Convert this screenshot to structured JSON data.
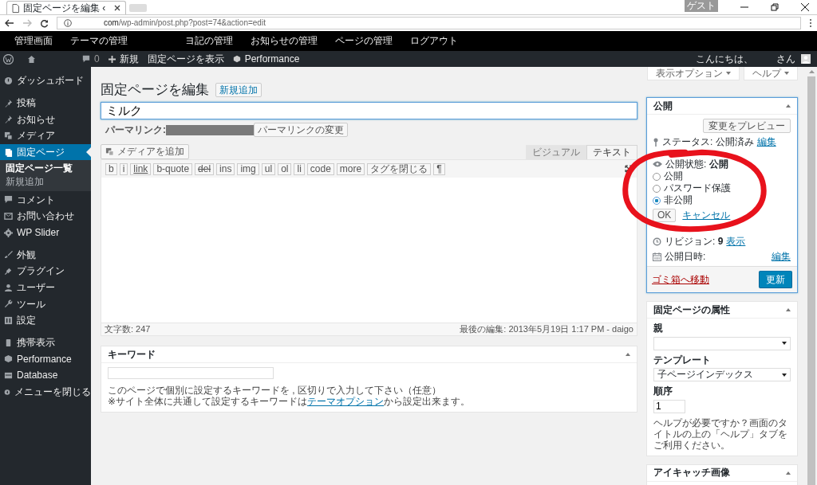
{
  "browser": {
    "tab_title": "固定ページを編集 ‹",
    "url_host": "com",
    "url_path": "/wp-admin/post.php?post=74&action=edit",
    "profile": "ゲスト"
  },
  "site_nav": [
    "管理画面",
    "テーマの管理",
    "ヨ記の管理",
    "お知らせの管理",
    "ページの管理",
    "ログアウト"
  ],
  "admin_bar": {
    "comments": "0",
    "new": "新規",
    "view": "固定ページを表示",
    "performance": "Performance",
    "greeting": "こんにちは、",
    "user": "さん"
  },
  "sidebar": [
    {
      "items": [
        {
          "label": "ダッシュボード",
          "selected": false
        }
      ]
    },
    {
      "items": [
        {
          "label": "投稿",
          "selected": false
        },
        {
          "label": "お知らせ",
          "selected": false
        },
        {
          "label": "メディア",
          "selected": false
        },
        {
          "label": "固定ページ",
          "selected": true,
          "children": [
            {
              "label": "固定ページ一覧",
              "selected": true
            },
            {
              "label": "新規追加",
              "selected": false
            }
          ]
        },
        {
          "label": "コメント",
          "selected": false
        },
        {
          "label": "お問い合わせ",
          "selected": false
        },
        {
          "label": "WP Slider",
          "selected": false
        }
      ]
    },
    {
      "items": [
        {
          "label": "外観",
          "selected": false
        },
        {
          "label": "プラグイン",
          "selected": false
        },
        {
          "label": "ユーザー",
          "selected": false
        },
        {
          "label": "ツール",
          "selected": false
        },
        {
          "label": "設定",
          "selected": false
        }
      ]
    },
    {
      "items": [
        {
          "label": "携帯表示",
          "selected": false
        },
        {
          "label": "Performance",
          "selected": false
        },
        {
          "label": "Database",
          "selected": false
        },
        {
          "label": "メニューを閉じる",
          "selected": false
        }
      ]
    }
  ],
  "screen_options": "表示オプション",
  "help": "ヘルプ",
  "page": {
    "heading": "固定ページを編集",
    "add_new": "新規追加",
    "title": "ミルク",
    "permalink_label": "パーマリンク:",
    "permalink_button": "パーマリンクの変更",
    "add_media": "メディアを追加",
    "editor_tabs": [
      {
        "label": "ビジュアル",
        "selected": false
      },
      {
        "label": "テキスト",
        "selected": true
      }
    ],
    "quicktags": [
      {
        "label": "b",
        "kind": "plain"
      },
      {
        "label": "i",
        "kind": "plain"
      },
      {
        "label": "link",
        "kind": "underline"
      },
      {
        "label": "b-quote",
        "kind": "plain"
      },
      {
        "label": "del",
        "kind": "strike"
      },
      {
        "label": "ins",
        "kind": "plain"
      },
      {
        "label": "img",
        "kind": "plain"
      },
      {
        "label": "ul",
        "kind": "plain"
      },
      {
        "label": "ol",
        "kind": "plain"
      },
      {
        "label": "li",
        "kind": "plain"
      },
      {
        "label": "code",
        "kind": "plain"
      },
      {
        "label": "more",
        "kind": "plain"
      },
      {
        "label": "タグを閉じる",
        "kind": "plain"
      },
      {
        "label": "¶",
        "kind": "plain"
      }
    ],
    "word_count": "文字数: 247",
    "last_edit": "最後の編集: 2013年5月19日 1:17 PM - daigo"
  },
  "keywords": {
    "title": "キーワード",
    "help_1": "このページで個別に設定するキーワードを , 区切りで入力して下さい（任意）",
    "help_2_before": "※サイト全体に共通して設定するキーワードは",
    "help_2_link": "テーマオプション",
    "help_2_after": "から設定出来ます。"
  },
  "publish": {
    "title": "公開",
    "preview": "変更をプレビュー",
    "status": "ステータス: 公開済み",
    "status_edit": "編集",
    "visibility": "公開状態: **公開**",
    "radios": [
      {
        "label": "公開",
        "selected": false
      },
      {
        "label": "パスワード保護",
        "selected": false
      },
      {
        "label": "非公開",
        "selected": true
      }
    ],
    "ok": "OK",
    "cancel": "キャンセル",
    "revisions": "リビジョン: **9**",
    "revisions_link": "表示",
    "date": "公開日時:",
    "date_edit": "編集",
    "trash": "ゴミ箱へ移動",
    "update": "更新"
  },
  "attributes": {
    "title": "固定ページの属性",
    "parent_label": "親",
    "template_label": "テンプレート",
    "template": "子ページインデックス",
    "order_label": "順序",
    "order": "1",
    "help": "ヘルプが必要ですか？画面のタイトルの上の「ヘルプ」タブをご利用ください。"
  },
  "eyecatch": {
    "title": "アイキャッチ画像"
  }
}
